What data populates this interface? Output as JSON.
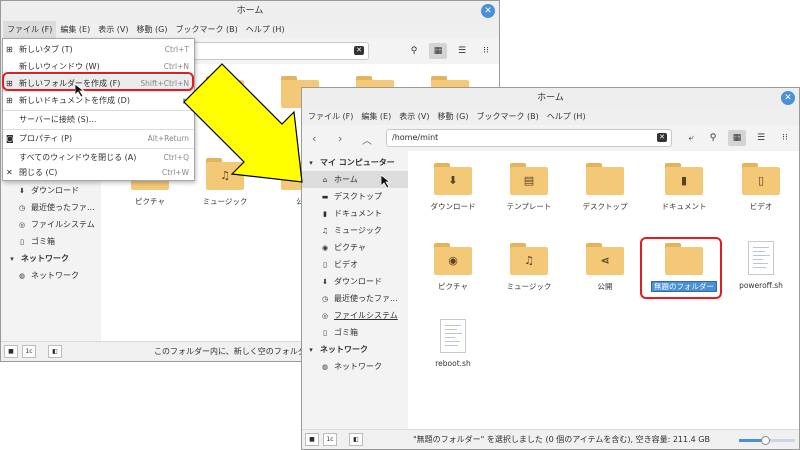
{
  "back_window": {
    "title": "ホーム",
    "menu": [
      "ファイル (F)",
      "編集 (E)",
      "表示 (V)",
      "移動 (G)",
      "ブックマーク (B)",
      "ヘルプ (H)"
    ],
    "dropdown": [
      {
        "icon": "+",
        "label": "新しいタブ (T)",
        "accel": "Ctrl+T"
      },
      {
        "icon": "",
        "label": "新しいウィンドウ (W)",
        "accel": "Ctrl+N"
      },
      {
        "icon": "+",
        "label": "新しいフォルダーを作成 (F)",
        "accel": "Shift+Ctrl+N"
      },
      {
        "icon": "+",
        "label": "新しいドキュメントを作成 (D)",
        "accel": "▶"
      },
      {
        "icon": "",
        "label": "サーバーに接続 (S)...",
        "accel": ""
      },
      {
        "icon": "Q",
        "label": "プロパティ (P)",
        "accel": "Alt+Return"
      },
      {
        "icon": "",
        "label": "すべてのウィンドウを閉じる (A)",
        "accel": "Ctrl+Q"
      },
      {
        "icon": "✕",
        "label": "閉じる (C)",
        "accel": "Ctrl+W"
      }
    ],
    "sidebar": [
      "ダウンロード",
      "最近使ったファ...",
      "ファイルシステム",
      "ゴミ箱",
      "ネットワーク",
      "ネットワーク"
    ],
    "icons": [
      "ピクチャ",
      "ミュージック",
      "公"
    ],
    "status": "このフォルダー内に、新しく空のフォルダーを"
  },
  "front_window": {
    "title": "ホーム",
    "menu": [
      "ファイル (F)",
      "編集 (E)",
      "表示 (V)",
      "移動 (G)",
      "ブックマーク (B)",
      "ヘルプ (H)"
    ],
    "path": "/home/mint",
    "sidebar": {
      "section1": "マイ コンピューター",
      "items": [
        "ホーム",
        "デスクトップ",
        "ドキュメント",
        "ミュージック",
        "ピクチャ",
        "ビデオ",
        "ダウンロード",
        "最近使ったファ...",
        "ファイルシステム",
        "ゴミ箱"
      ],
      "section2": "ネットワーク",
      "items2": [
        "ネットワーク"
      ]
    },
    "files": [
      {
        "label": "ダウンロード",
        "glyph": "⬇"
      },
      {
        "label": "テンプレート",
        "glyph": "▤"
      },
      {
        "label": "デスクトップ",
        "glyph": ""
      },
      {
        "label": "ドキュメント",
        "glyph": "▮"
      },
      {
        "label": "ビデオ",
        "glyph": "▯"
      },
      {
        "label": "ピクチャ",
        "glyph": "◉"
      },
      {
        "label": "ミュージック",
        "glyph": "♫"
      },
      {
        "label": "公開",
        "glyph": "⋖"
      },
      {
        "label": "無題のフォルダー",
        "glyph": ""
      },
      {
        "label": "poweroff.sh",
        "glyph": ""
      },
      {
        "label": "reboot.sh",
        "glyph": ""
      }
    ],
    "status": "\"無題のフォルダー\" を選択しました (0 個のアイテムを含む), 空き容量: 211.4 GB"
  },
  "colors": {
    "highlight": "#e31b23",
    "arrow": "#ffff00",
    "selection": "#4a90d9"
  }
}
